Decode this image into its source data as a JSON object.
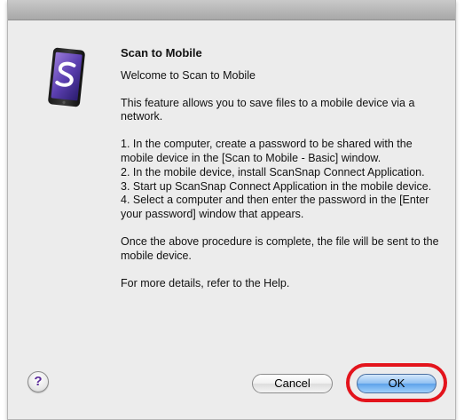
{
  "dialog": {
    "title": "Scan to Mobile",
    "welcome": "Welcome to Scan to Mobile",
    "intro": "This feature allows you to save files to a mobile device via a network.",
    "steps": [
      "1. In the computer, create a password to be shared with the mobile device in the [Scan to Mobile - Basic] window.",
      "2. In the mobile device, install ScanSnap Connect Application.",
      "3. Start up ScanSnap Connect Application in the mobile device.",
      "4. Select a computer and then enter the password in the [Enter your password] window that appears."
    ],
    "completion": "Once the above procedure is complete, the file will be sent to the mobile device.",
    "help_text": "For more details, refer to the Help."
  },
  "buttons": {
    "help_label": "?",
    "cancel_label": "Cancel",
    "ok_label": "OK"
  },
  "icons": {
    "app": "scan-to-mobile-tablet-icon",
    "help": "help-icon"
  },
  "colors": {
    "highlight": "#e3141c",
    "ok_button": "#5ea2ea"
  }
}
